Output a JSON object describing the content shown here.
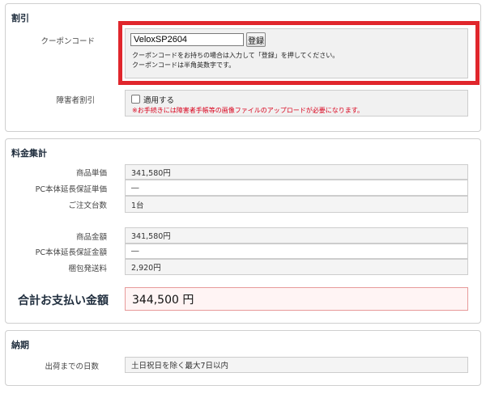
{
  "discount": {
    "title": "割引",
    "coupon_label": "クーポンコード",
    "coupon_value": "VeloxSP2604",
    "coupon_button": "登録",
    "note1": "クーポンコードをお持ちの場合は入力して「登録」を押してください。",
    "note2": "クーポンコードは半角英数字です。",
    "disability_label": "障害者割引",
    "apply_label": "適用する",
    "apply_checked": false,
    "warning": "※お手続きには障害者手帳等の画像ファイルのアップロードが必要になります。"
  },
  "summary": {
    "title": "料金集計",
    "rows_a": [
      {
        "label": "商品単価",
        "value": "341,580円"
      },
      {
        "label": "PC本体延長保証単価",
        "value": "―"
      },
      {
        "label": "ご注文台数",
        "value": "1台"
      }
    ],
    "rows_b": [
      {
        "label": "商品金額",
        "value": "341,580円"
      },
      {
        "label": "PC本体延長保証金額",
        "value": "―"
      },
      {
        "label": "梱包発送料",
        "value": "2,920円"
      }
    ],
    "total_label": "合計お支払い金額",
    "total_value": "344,500 円"
  },
  "delivery": {
    "title": "納期",
    "days_label": "出荷までの日数",
    "days_value": "土日祝日を除く最大7日以内"
  },
  "colors": {
    "highlight": "#e0262c",
    "warning_text": "#d9001b",
    "total_border": "#e79a9a"
  }
}
